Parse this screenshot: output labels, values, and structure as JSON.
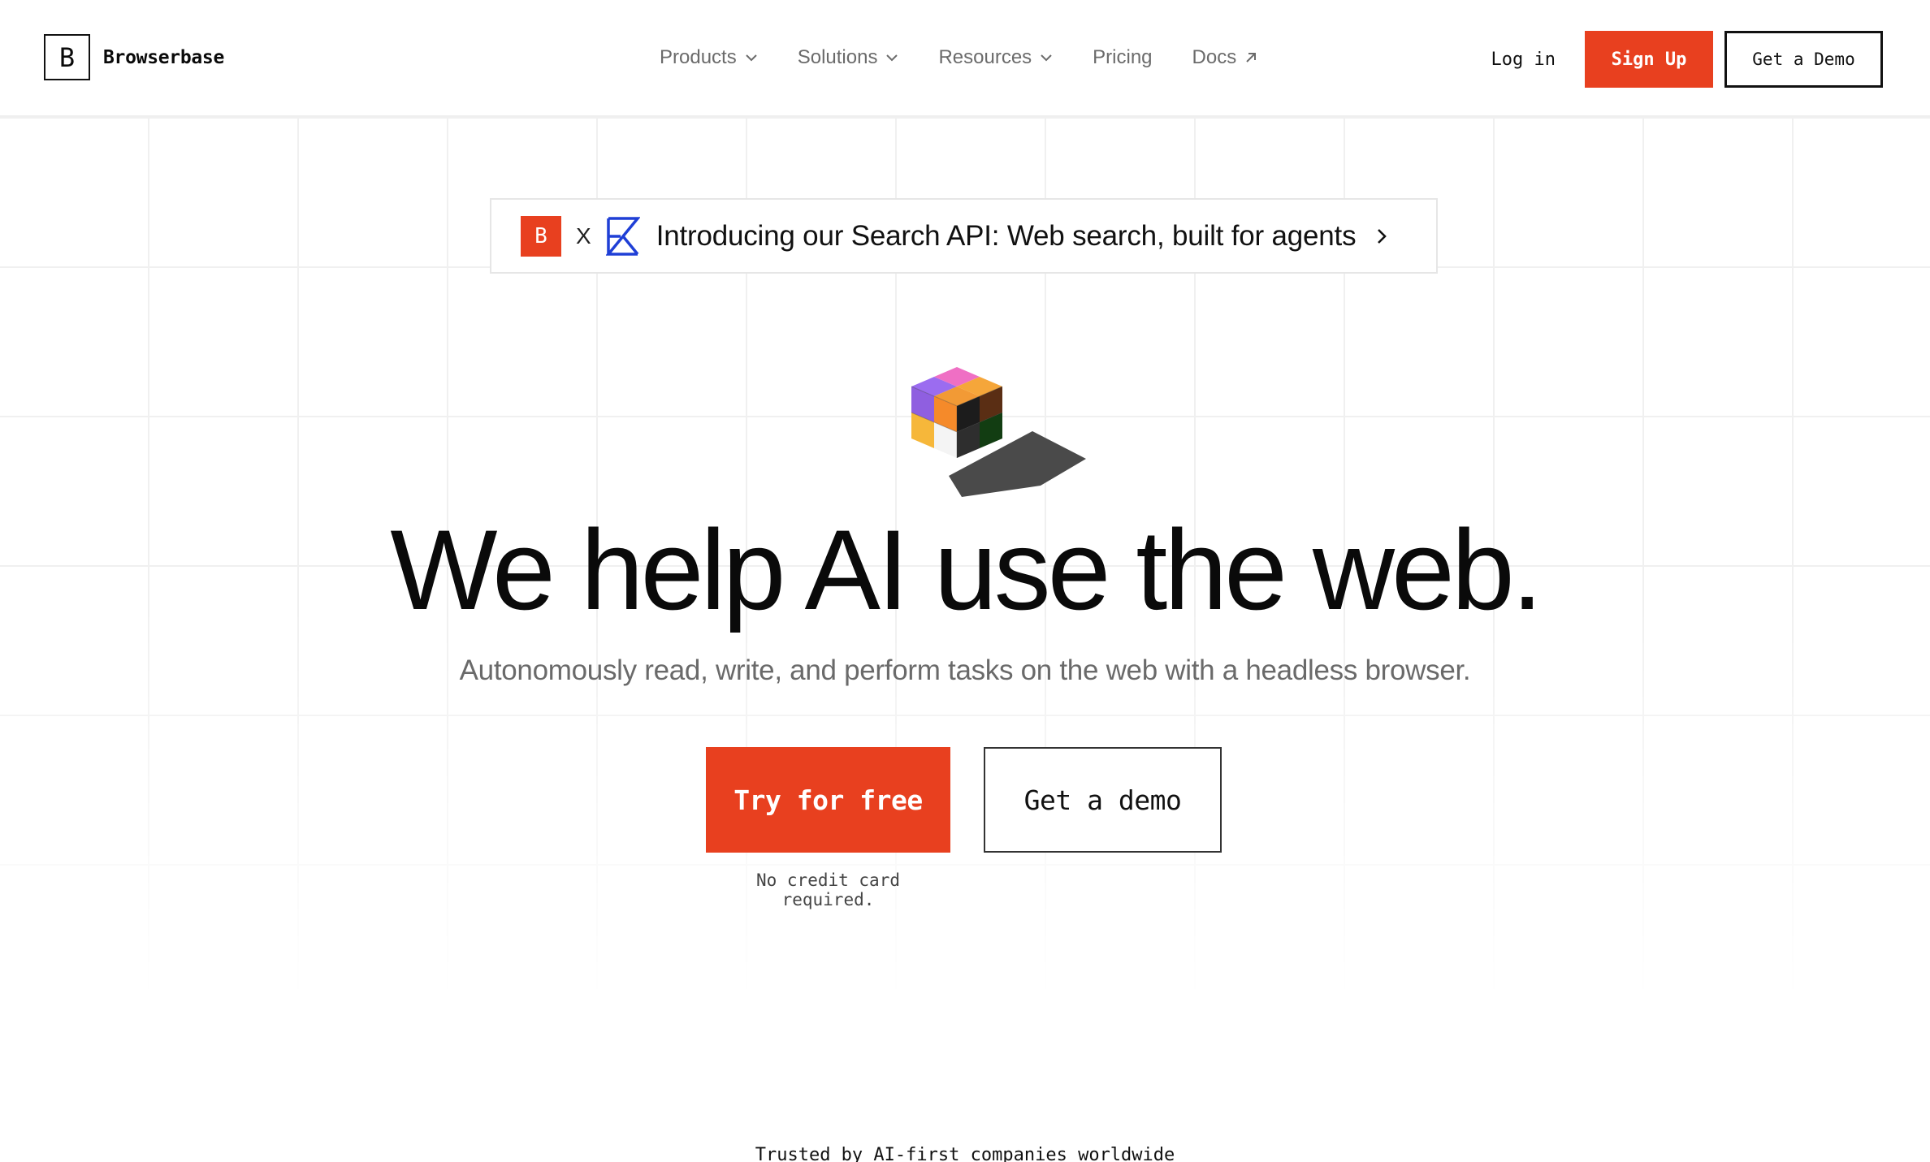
{
  "brand": {
    "mark": "B",
    "name": "Browserbase"
  },
  "nav": {
    "items": [
      {
        "label": "Products",
        "icon": "chevron-down-icon"
      },
      {
        "label": "Solutions",
        "icon": "chevron-down-icon"
      },
      {
        "label": "Resources",
        "icon": "chevron-down-icon"
      },
      {
        "label": "Pricing"
      },
      {
        "label": "Docs",
        "icon": "arrow-up-right-icon"
      }
    ],
    "login": "Log in",
    "signup": "Sign Up",
    "demo": "Get a Demo"
  },
  "announcement": {
    "badge": "B",
    "separator": "X",
    "partner_icon": "exa-logo-icon",
    "text": "Introducing our Search API: Web search, built for agents",
    "icon": "chevron-right-icon"
  },
  "hero": {
    "illustration": "cube-icon",
    "title": "We help AI use the web.",
    "subtitle": "Autonomously read, write, and perform tasks on the web with a headless browser.",
    "cta_primary": "Try for free",
    "cta_secondary": "Get a demo",
    "note": "No credit card required."
  },
  "trusted": "Trusted by AI-first companies worldwide",
  "colors": {
    "accent": "#e8401f",
    "partner_blue": "#1f3fd6",
    "text": "#0a0a0a",
    "muted": "#6a6a6a",
    "grid": "#f0f0f0"
  }
}
